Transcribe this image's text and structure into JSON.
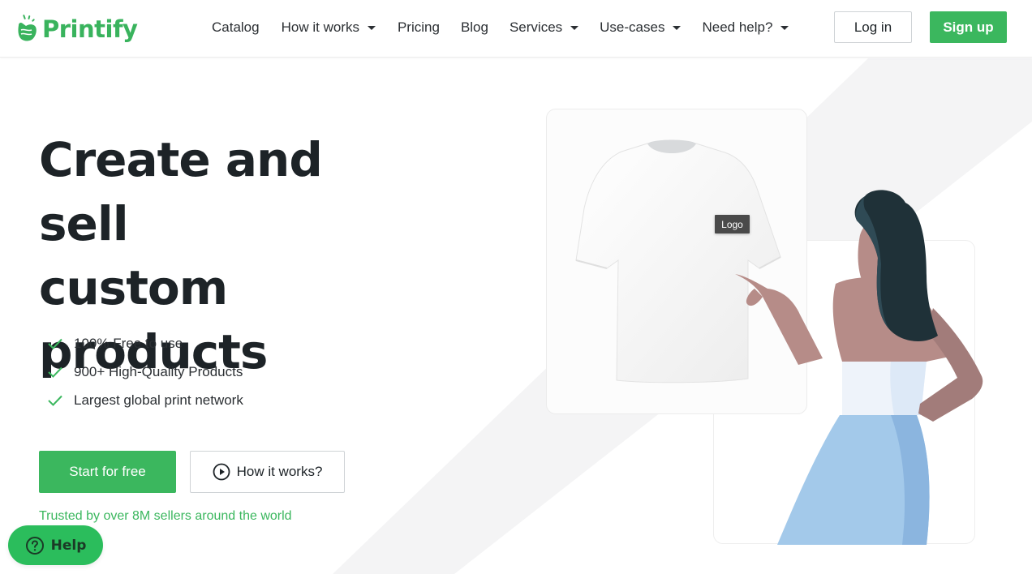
{
  "header": {
    "brand": "Printify",
    "nav": [
      {
        "label": "Catalog",
        "has_dropdown": false
      },
      {
        "label": "How it works",
        "has_dropdown": true
      },
      {
        "label": "Pricing",
        "has_dropdown": false
      },
      {
        "label": "Blog",
        "has_dropdown": false
      },
      {
        "label": "Services",
        "has_dropdown": true
      },
      {
        "label": "Use-cases",
        "has_dropdown": true
      },
      {
        "label": "Need help?",
        "has_dropdown": true
      }
    ],
    "login_label": "Log in",
    "signup_label": "Sign up"
  },
  "hero": {
    "title_lines": [
      "Create and sell",
      "custom",
      "products"
    ],
    "features": [
      {
        "icon": "check-icon",
        "label": "100% Free to use"
      },
      {
        "icon": "check-icon",
        "label": "900+ High-Quality Products"
      },
      {
        "icon": "check-icon",
        "label": "Largest global print network"
      }
    ],
    "primary_cta": "Start for free",
    "secondary_cta": "How it works?",
    "secondary_cta_icon": "play-circle-icon",
    "trusted_text": "Trusted by over 8M sellers around the world",
    "mockup_tag": "Logo"
  },
  "help_widget": {
    "label": "Help",
    "icon": "question-circle-icon"
  },
  "colors": {
    "brand_green": "#3bb75e",
    "text_dark": "#1d2327",
    "help_green": "#2bbd5c"
  }
}
